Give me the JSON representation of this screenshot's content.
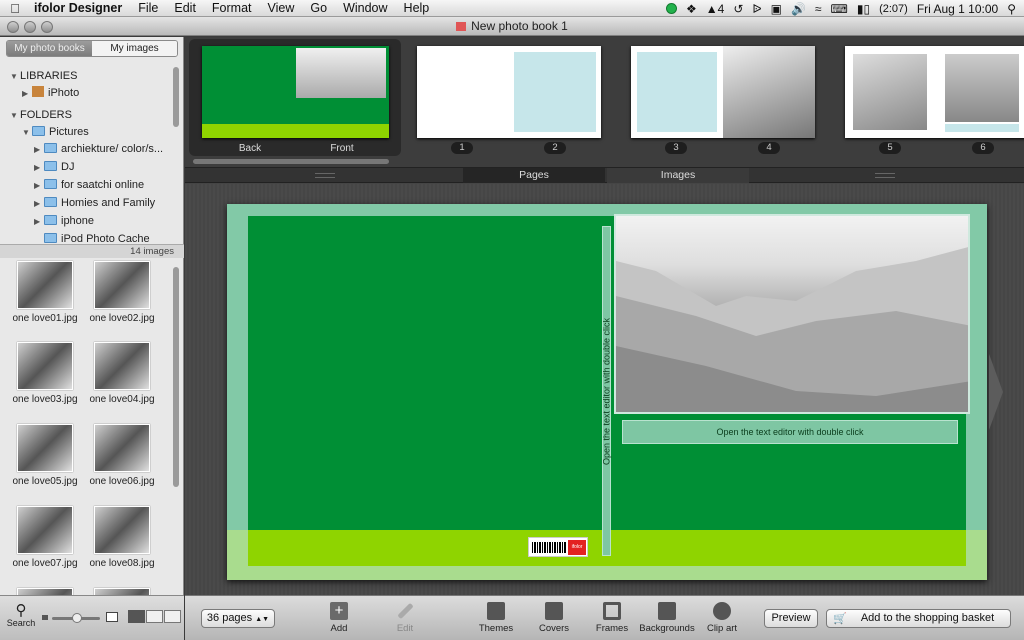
{
  "menubar": {
    "app": "ifolor Designer",
    "items": [
      "File",
      "Edit",
      "Format",
      "View",
      "Go",
      "Window",
      "Help"
    ],
    "status": {
      "adobe": "4",
      "battery": "(2:07)",
      "datetime": "Fri Aug 1  10:00"
    }
  },
  "window": {
    "title": "New photo book 1"
  },
  "sidebar": {
    "tabs": [
      "My photo books",
      "My images"
    ],
    "libraries_header": "LIBRARIES",
    "iphoto": "iPhoto",
    "folders_header": "FOLDERS",
    "pictures": "Pictures",
    "subfolders": [
      "archiekture/ color/s...",
      "DJ",
      "for saatchi online",
      "Homies and Family",
      "iphone",
      "iPod Photo Cache"
    ],
    "image_count": "14 images",
    "images": [
      "one love01.jpg",
      "one love02.jpg",
      "one love03.jpg",
      "one love04.jpg",
      "one love05.jpg",
      "one love06.jpg",
      "one love07.jpg",
      "one love08.jpg"
    ],
    "search_label": "Search"
  },
  "strip": {
    "cover_labels": [
      "Back",
      "Front"
    ],
    "page_numbers": [
      "1",
      "2",
      "3",
      "4",
      "5",
      "6"
    ]
  },
  "page_tabs": [
    "Pages",
    "Images"
  ],
  "editor": {
    "text_placeholder": "Open the text editor with double click",
    "spine_placeholder": "Open the text editor with double click",
    "logo": "ifolor"
  },
  "toolbar": {
    "pages_select": "36 pages",
    "add": "Add",
    "edit": "Edit",
    "themes": "Themes",
    "covers": "Covers",
    "frames": "Frames",
    "backgrounds": "Backgrounds",
    "clipart": "Clip art",
    "preview": "Preview",
    "basket": "Add to the shopping basket"
  },
  "colors": {
    "cover_green": "#008f35",
    "lime": "#8fd400",
    "mint": "#82c9a7"
  }
}
